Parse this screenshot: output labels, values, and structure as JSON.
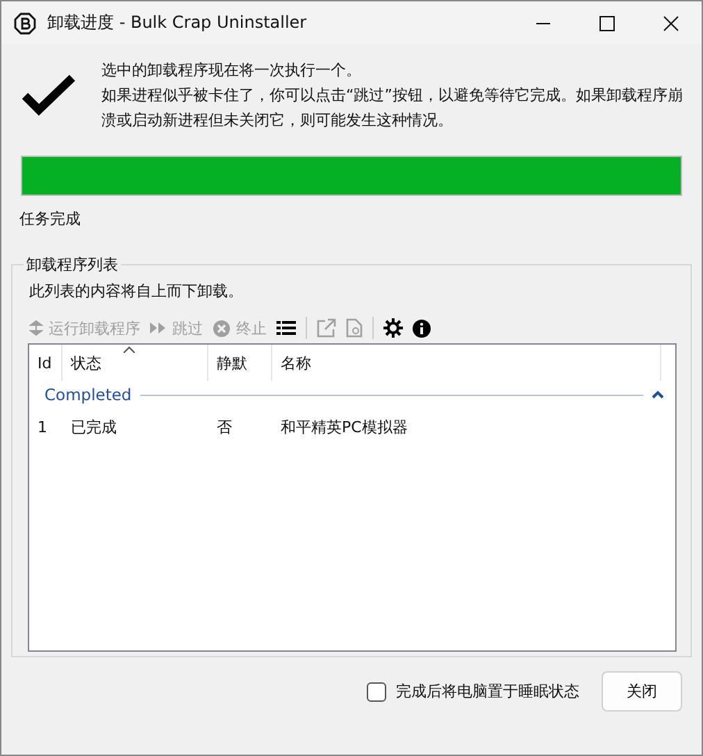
{
  "window": {
    "title": "卸载进度 - Bulk Crap Uninstaller"
  },
  "message": {
    "lines": [
      "选中的卸载程序现在将一次执行一个。",
      "如果进程似乎被卡住了，你可以点击“跳过”按钮，以避免等待它完成。如果卸载程序崩溃或启动新进程但未关闭它，则可能发生这种情况。"
    ]
  },
  "progress": {
    "level": 1,
    "status": "任务完成"
  },
  "group": {
    "title": "卸载程序列表",
    "description": "此列表的内容将自上而下卸载。",
    "toolbar": [
      {
        "kind": "run",
        "label": "运行卸载程序",
        "disabled": true
      },
      {
        "kind": "skip",
        "label": "跳过",
        "disabled": true
      },
      {
        "kind": "stop",
        "label": "终止",
        "disabled": true
      },
      {
        "kind": "list",
        "disabled": false
      },
      {
        "kind": "separator"
      },
      {
        "kind": "external",
        "disabled": true
      },
      {
        "kind": "document",
        "disabled": true
      },
      {
        "kind": "separator"
      },
      {
        "kind": "settings",
        "disabled": false
      },
      {
        "kind": "info",
        "disabled": false
      }
    ],
    "table": {
      "columns": [
        {
          "label": "Id",
          "sorted": false
        },
        {
          "label": "状态",
          "sorted": true
        },
        {
          "label": "静默",
          "sorted": false
        },
        {
          "label": "名称",
          "sorted": false
        }
      ],
      "groups": [
        {
          "name": "Completed",
          "expanded": true,
          "rows": [
            [
              "1",
              "已完成",
              "否",
              "和平精英PC模拟器"
            ]
          ]
        }
      ]
    }
  },
  "sleep_checkbox": {
    "label": "完成后将电脑置于睡眠状态",
    "checked": false
  },
  "buttons": [
    "关闭"
  ]
}
